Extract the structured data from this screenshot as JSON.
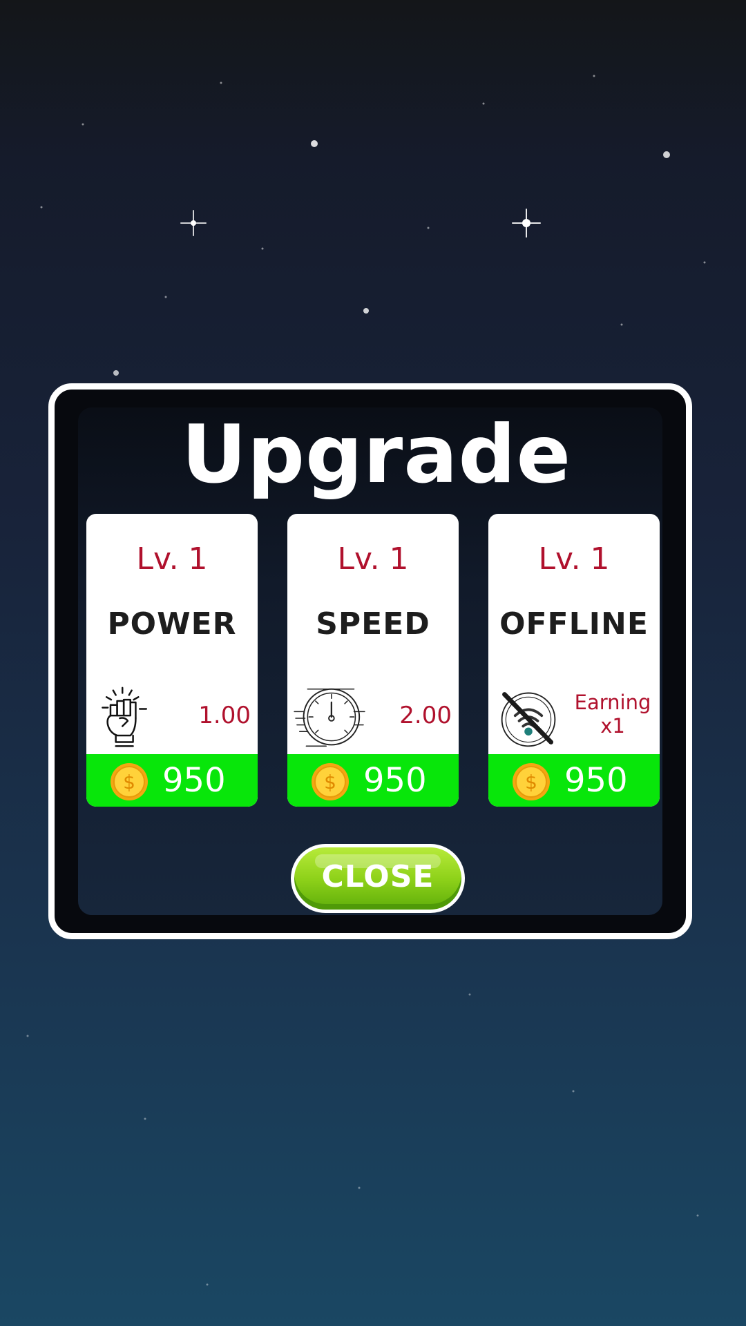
{
  "dialog": {
    "title": "Upgrade",
    "close_label": "CLOSE"
  },
  "cards": [
    {
      "level": "Lv. 1",
      "name": "POWER",
      "stat": "1.00",
      "price": "950",
      "icon": "fist-icon"
    },
    {
      "level": "Lv. 1",
      "name": "SPEED",
      "stat": "2.00",
      "price": "950",
      "icon": "speedometer-icon"
    },
    {
      "level": "Lv. 1",
      "name": "OFFLINE",
      "stat_line1": "Earning",
      "stat_line2": "x1",
      "price": "950",
      "icon": "no-wifi-icon"
    }
  ],
  "colors": {
    "level_text": "#b0112d",
    "price_bar": "#08e60a",
    "button_green": "#8fd21a"
  }
}
